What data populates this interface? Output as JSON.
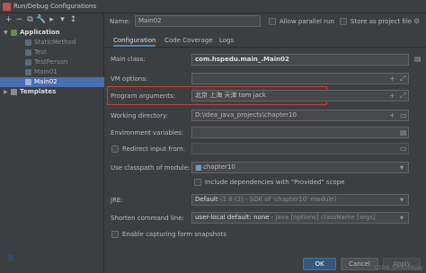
{
  "window": {
    "title": "Run/Debug Configurations"
  },
  "toolbar": [
    "+",
    "−",
    "⧉",
    "🔧",
    "▸",
    "▾",
    "↕"
  ],
  "tree": {
    "group_label": "Application",
    "items": [
      "StaticMethod",
      "Test",
      "TestPerson",
      "Main01",
      "Main02"
    ],
    "selected": "Main02",
    "templates_label": "Templates"
  },
  "header": {
    "name_label": "Name:",
    "name_value": "Main02",
    "allow_parallel_label": "Allow parallel run",
    "store_as_file_label": "Store as project file"
  },
  "tabs": [
    "Configuration",
    "Code Coverage",
    "Logs"
  ],
  "form": {
    "main_class_label": "Main class:",
    "main_class_value": "com.hspedu.main_.Main02",
    "vm_options_label": "VM options:",
    "vm_options_value": "",
    "program_args_label": "Program arguments:",
    "program_args_value": "北京 上海 天津 tom jack",
    "working_dir_label": "Working directory:",
    "working_dir_value": "D:\\idea_java_projects\\chapter10",
    "env_vars_label": "Environment variables:",
    "env_vars_value": "",
    "redirect_label": "Redirect input from:",
    "classpath_label": "Use classpath of module:",
    "classpath_value": "chapter10",
    "include_deps_label": "Include dependencies with \"Provided\" scope",
    "jre_label": "JRE:",
    "jre_value": "Default",
    "jre_detail": "(1.8 (2) - SDK of 'chapter10' module)",
    "shorten_label": "Shorten command line:",
    "shorten_value": "user-local default: none",
    "shorten_detail": "- java [options] className [args]",
    "capture_label": "Enable capturing form snapshots"
  },
  "buttons": {
    "ok": "OK",
    "cancel": "Cancel",
    "apply": "Apply"
  },
  "watermark": "CSDN @roundsjay",
  "colors": {
    "highlight": "#d23b3b",
    "selection": "#4b6eaf",
    "accent": "#4a88c7"
  }
}
